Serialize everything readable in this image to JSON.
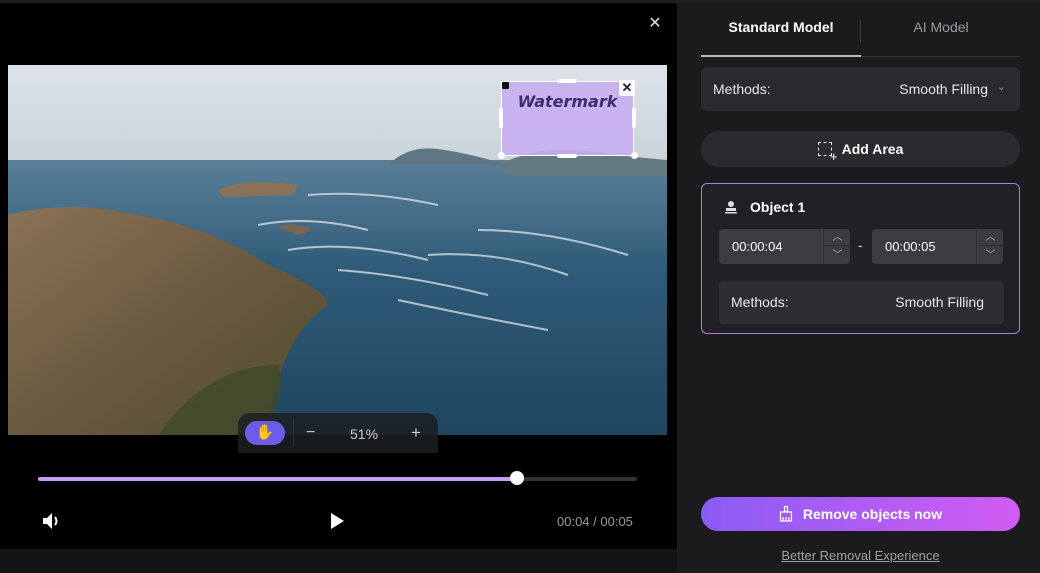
{
  "player": {
    "close_icon": "close-icon",
    "watermark_text": "Watermark",
    "zoom_level": "51%",
    "zoom_minus": "−",
    "zoom_plus": "+",
    "progress_fraction": 0.8,
    "time_display": "00:04 / 00:05"
  },
  "panel": {
    "tabs": [
      {
        "label": "Standard Model",
        "active": true
      },
      {
        "label": "AI Model",
        "active": false
      }
    ],
    "methods_label": "Methods:",
    "methods_value": "Smooth Filling",
    "add_area_label": "Add Area",
    "object": {
      "title": "Object 1",
      "start_time": "00:00:04",
      "end_time": "00:00:05",
      "separator": "-",
      "methods_label": "Methods:",
      "methods_value": "Smooth Filling"
    },
    "remove_label": "Remove objects now",
    "better_link": "Better Removal Experience"
  },
  "colors": {
    "accent_purple": "#a77fe0",
    "progress_fill": "#c89cf5",
    "hand_button": "#6c5ce7",
    "gradient_start": "#8a5cf5",
    "gradient_end": "#d15cf2"
  }
}
